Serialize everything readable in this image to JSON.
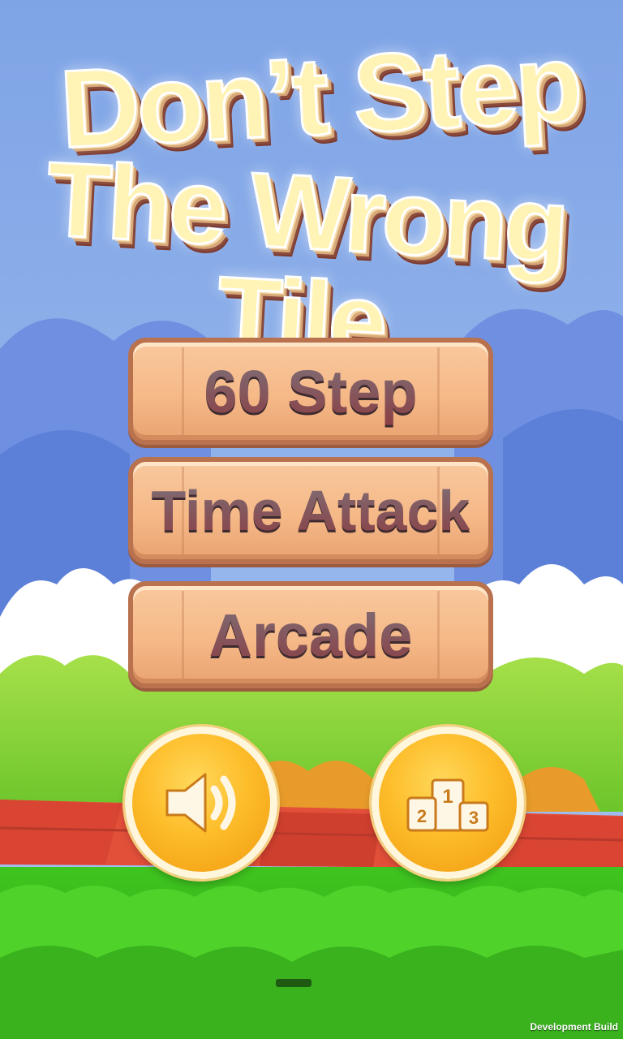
{
  "game_title": {
    "line1": "Don’t Step",
    "line2": "The Wrong Tile"
  },
  "menu": {
    "mode_60_step": "60 Step",
    "mode_time_attack": "Time Attack",
    "mode_arcade": "Arcade"
  },
  "controls": {
    "sound_icon": "speaker-icon",
    "leaderboard_icon": "podium-icon",
    "podium_places": [
      "2",
      "1",
      "3"
    ]
  },
  "footer": {
    "build_label": "Development Build"
  },
  "colors": {
    "sky": "#8fb2ea",
    "button_wood": "#f6b988",
    "button_text": "#8a3f44",
    "circle_button": "#fdbd2a",
    "grass": "#56cc2e",
    "tiles": "#e3503a"
  }
}
